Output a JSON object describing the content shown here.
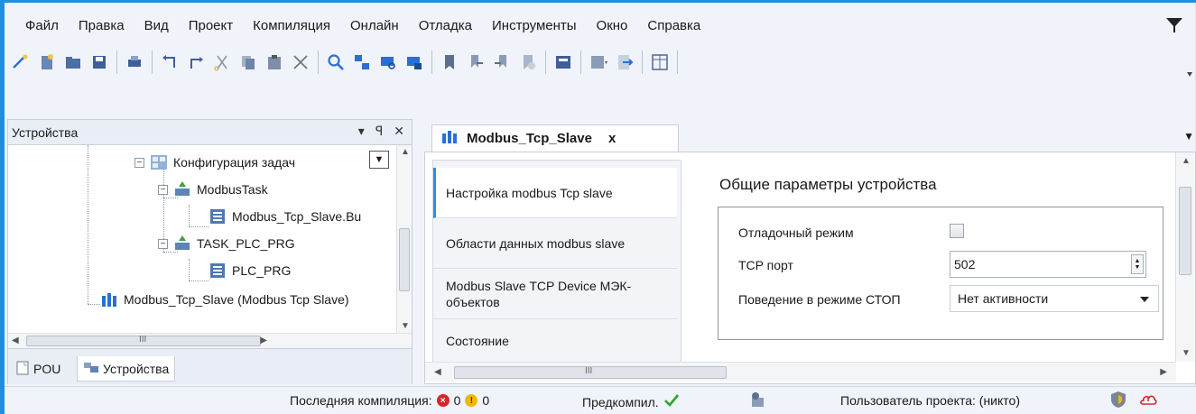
{
  "menu": {
    "items": [
      "Файл",
      "Правка",
      "Вид",
      "Проект",
      "Компиляция",
      "Онлайн",
      "Отладка",
      "Инструменты",
      "Окно",
      "Справка"
    ]
  },
  "devices_panel": {
    "title": "Устройства",
    "ctrl_dropdown": "▾",
    "ctrl_pin": "ꟼ",
    "ctrl_close": "✕",
    "tree": [
      {
        "label": "Конфигурация задач",
        "icon": "task-config-icon"
      },
      {
        "label": "ModbusTask",
        "icon": "task-icon"
      },
      {
        "label": "Modbus_Tcp_Slave.Bu",
        "icon": "program-call-icon"
      },
      {
        "label": "TASK_PLC_PRG",
        "icon": "task-icon"
      },
      {
        "label": "PLC_PRG",
        "icon": "program-call-icon"
      },
      {
        "label": "Modbus_Tcp_Slave (Modbus Tcp Slave)",
        "icon": "modbus-device-icon"
      }
    ],
    "scroll_mid": "III",
    "tabs": {
      "pou": "POU",
      "devices": "Устройства"
    }
  },
  "editor": {
    "tab_title": "Modbus_Tcp_Slave",
    "tab_close": "x",
    "nav": [
      "Настройка modbus Tcp slave",
      "Области данных modbus slave",
      "Modbus Slave TCP Device МЭК-объектов",
      "Состояние"
    ],
    "section_title": "Общие параметры устройства",
    "fields": {
      "debug_label": "Отладочный режим",
      "tcp_port_label": "TCP порт",
      "tcp_port_value": "502",
      "stop_label": "Поведение в режиме СТОП",
      "stop_value": "Нет активности"
    },
    "scroll_mid": "III"
  },
  "statusbar": {
    "last_compile": "Последняя компиляция:",
    "errors": "0",
    "warnings": "0",
    "precompile": "Предкомпил.",
    "user": "Пользователь проекта: (никто)"
  },
  "colors": {
    "accent": "#1c8fe0",
    "error": "#d9262b",
    "warning": "#f2b705",
    "ok": "#2aa52a"
  }
}
